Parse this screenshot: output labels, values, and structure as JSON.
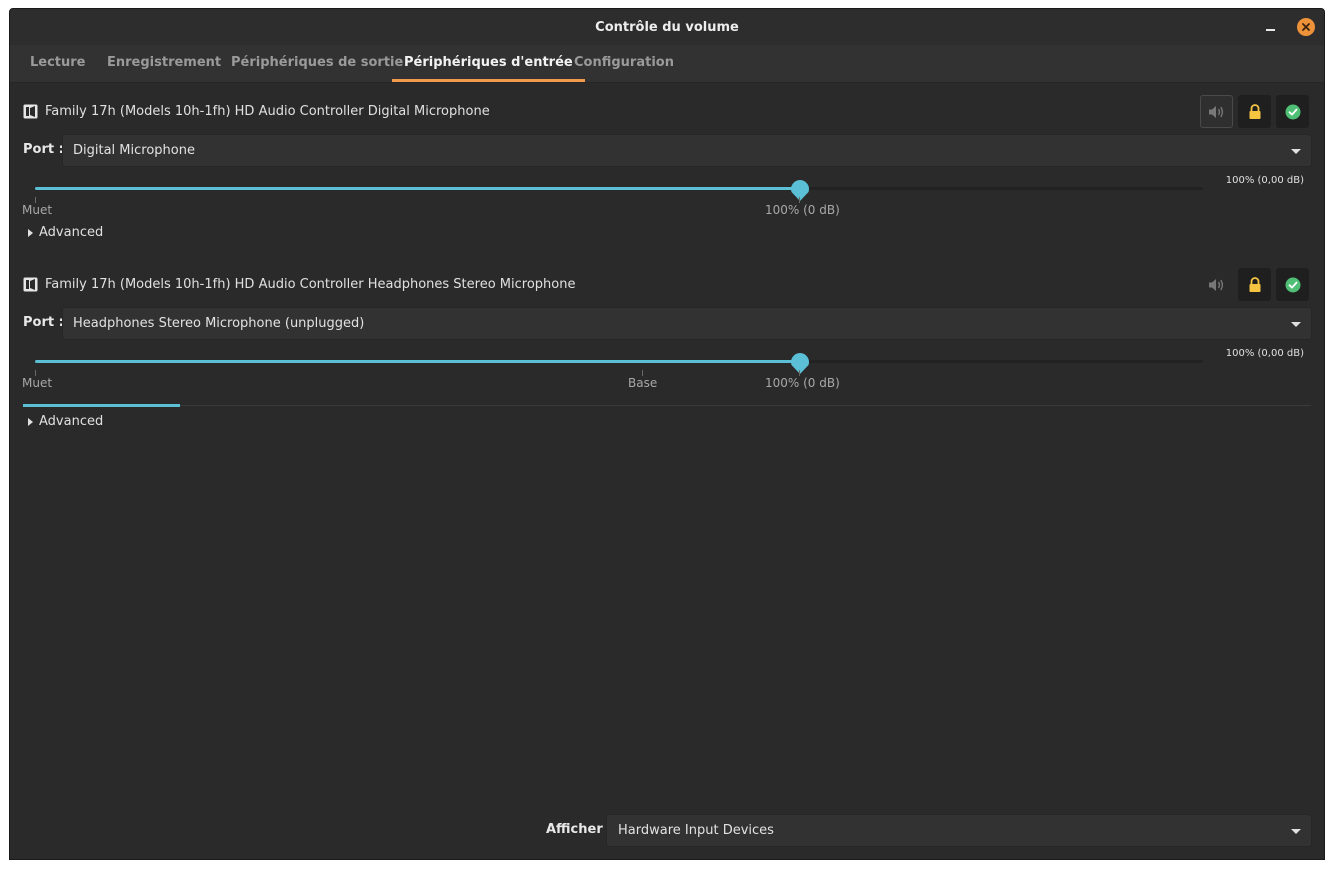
{
  "window": {
    "title": "Contrôle du volume"
  },
  "tabs": [
    {
      "label": "Lecture",
      "active": false
    },
    {
      "label": "Enregistrement",
      "active": false
    },
    {
      "label": "Périphériques de sortie",
      "active": false
    },
    {
      "label": "Périphériques d'entrée",
      "active": true
    },
    {
      "label": "Configuration",
      "active": false
    }
  ],
  "devices": [
    {
      "name": "Family 17h (Models 10h-1fh) HD Audio Controller Digital Microphone",
      "port_label": "Port :",
      "port_value": "Digital Microphone",
      "volume_percent": 100,
      "volume_readout": "100% (0,00 dB)",
      "marks": [
        "Muet",
        "100% (0 dB)"
      ],
      "advanced_label": "Advanced",
      "locked": true,
      "is_default": true
    },
    {
      "name": "Family 17h (Models 10h-1fh) HD Audio Controller Headphones Stereo Microphone",
      "port_label": "Port :",
      "port_value": "Headphones Stereo Microphone (unplugged)",
      "volume_percent": 100,
      "volume_readout": "100% (0,00 dB)",
      "marks": [
        "Muet",
        "Base",
        "100% (0 dB)"
      ],
      "advanced_label": "Advanced",
      "locked": true,
      "is_default": true
    }
  ],
  "footer": {
    "show_label": "Afficher :",
    "show_value": "Hardware Input Devices"
  },
  "colors": {
    "accent_tab": "#f19a4b",
    "slider": "#5bc0d5",
    "lock": "#f5c542",
    "default_check": "#4fbf75",
    "close_button": "#ee923a"
  },
  "icons": {
    "device": "audio-card-icon",
    "mute": "speaker-icon",
    "lock": "lock-icon",
    "default": "check-circle-icon",
    "close": "close-icon",
    "minimize": "minimize-icon"
  }
}
